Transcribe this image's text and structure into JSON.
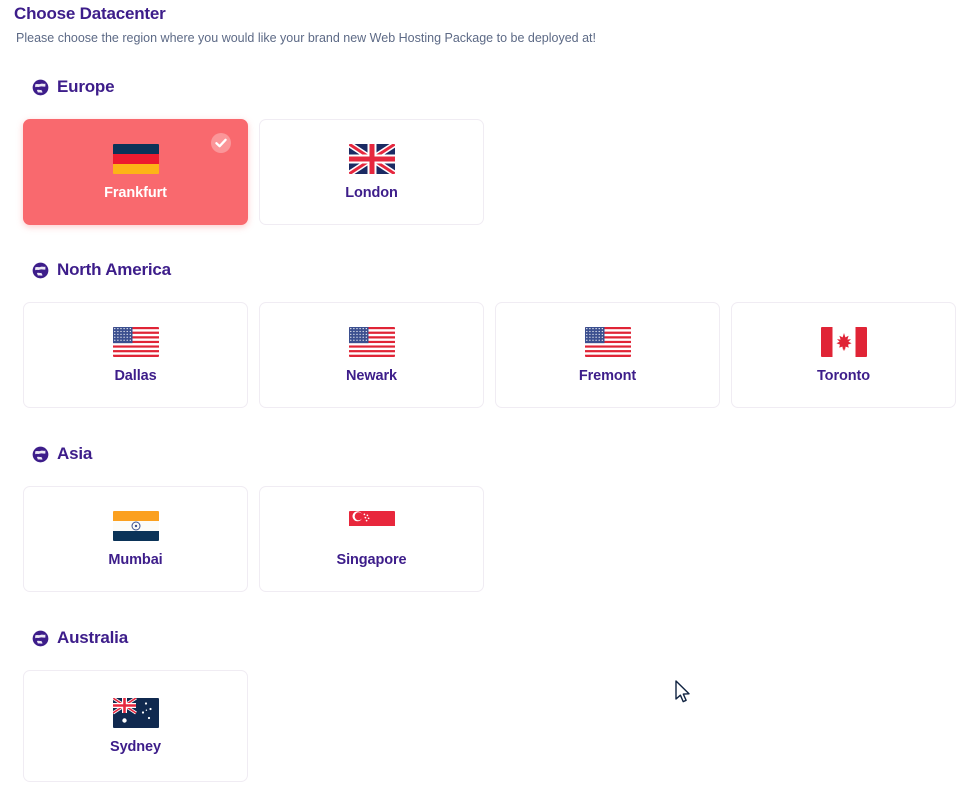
{
  "header": {
    "title": "Choose Datacenter",
    "subtitle": "Please choose the region where you would like your brand new Web Hosting Package to be deployed at!"
  },
  "colors": {
    "accent_purple": "#3d1d8a",
    "selected_red": "#f9696e",
    "subtitle_gray": "#5d6a86",
    "card_border": "#f0ecf3",
    "card_background": "#ffffff"
  },
  "icons": {
    "region": "globe-icon",
    "selected": "check-circle-icon",
    "cursor": "mouse-pointer-icon"
  },
  "regions": [
    {
      "id": "europe",
      "name": "Europe",
      "datacenters": [
        {
          "id": "frankfurt",
          "name": "Frankfurt",
          "country": "Germany",
          "flag": "de",
          "selected": true
        },
        {
          "id": "london",
          "name": "London",
          "country": "United Kingdom",
          "flag": "gb",
          "selected": false
        }
      ]
    },
    {
      "id": "north-america",
      "name": "North America",
      "datacenters": [
        {
          "id": "dallas",
          "name": "Dallas",
          "country": "United States",
          "flag": "us",
          "selected": false
        },
        {
          "id": "newark",
          "name": "Newark",
          "country": "United States",
          "flag": "us",
          "selected": false
        },
        {
          "id": "fremont",
          "name": "Fremont",
          "country": "United States",
          "flag": "us",
          "selected": false
        },
        {
          "id": "toronto",
          "name": "Toronto",
          "country": "Canada",
          "flag": "ca",
          "selected": false
        }
      ]
    },
    {
      "id": "asia",
      "name": "Asia",
      "datacenters": [
        {
          "id": "mumbai",
          "name": "Mumbai",
          "country": "India",
          "flag": "in",
          "selected": false
        },
        {
          "id": "singapore",
          "name": "Singapore",
          "country": "Singapore",
          "flag": "sg",
          "selected": false
        }
      ]
    },
    {
      "id": "australia",
      "name": "Australia",
      "datacenters": [
        {
          "id": "sydney",
          "name": "Sydney",
          "country": "Australia",
          "flag": "au",
          "selected": false
        }
      ]
    }
  ]
}
